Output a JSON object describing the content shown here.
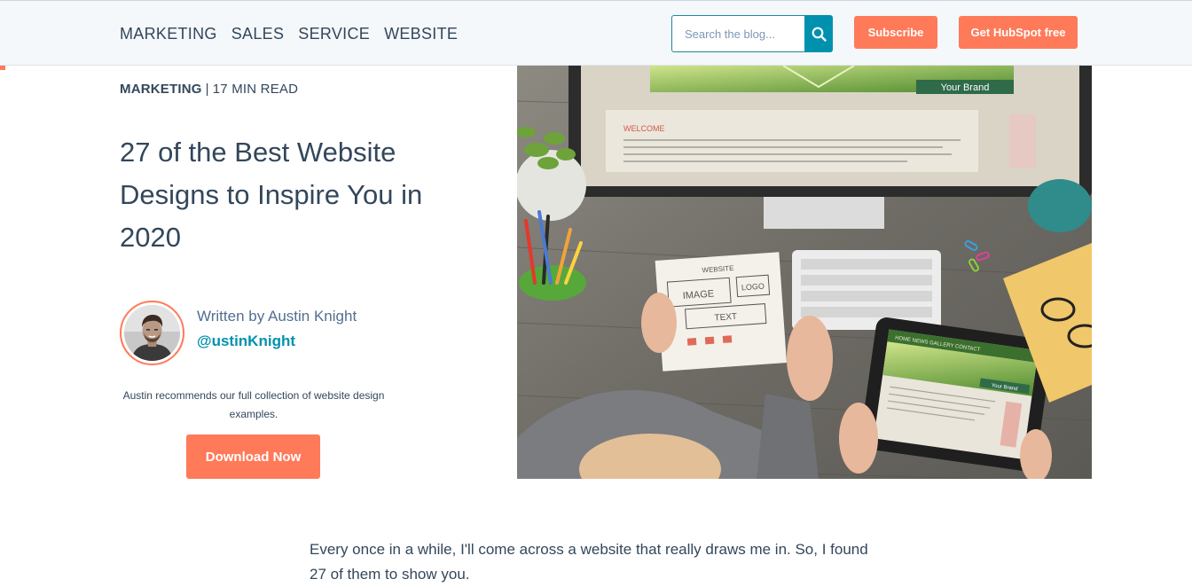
{
  "header": {
    "nav": [
      "MARKETING",
      "SALES",
      "SERVICE",
      "WEBSITE"
    ],
    "search": {
      "placeholder": "Search the blog..."
    },
    "subscribe_label": "Subscribe",
    "cta_label": "Get HubSpot free"
  },
  "article": {
    "topic": "MARKETING",
    "separator": "|",
    "read_time": "17 MIN READ",
    "title": "27 of the Best Website Designs to Inspire You in 2020",
    "author": {
      "written_by": "Written by Austin Knight",
      "handle": "@ustinKnight"
    },
    "recommendation": "Austin recommends our full collection of website design examples.",
    "download_label": "Download Now",
    "hero_image_texts": {
      "brand": "Your Brand",
      "welcome": "WELCOME",
      "sketch_heading": "WEBSITE",
      "sketch_image": "IMAGE",
      "sketch_logo": "LOGO",
      "sketch_text": "TEXT",
      "tablet_nav": "HOME  NEWS  GALLERY  CONTACT",
      "tablet_brand": "Your Brand"
    },
    "intro": "Every once in a while, I'll come across a website that really draws me in. So, I found 27 of them to show you."
  },
  "colors": {
    "accent": "#ff7a59",
    "link": "#0091ae",
    "text": "#33475b",
    "header_bg": "#f5f8fa"
  },
  "icons": {
    "search": "search-icon"
  }
}
